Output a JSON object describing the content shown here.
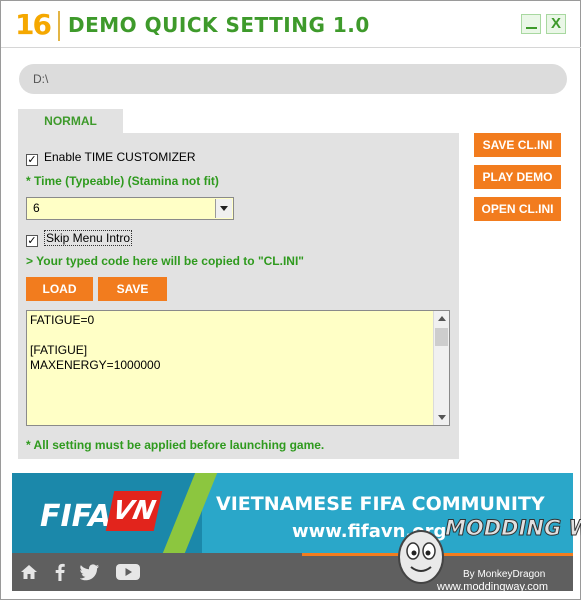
{
  "window": {
    "logo": "16",
    "title": "DEMO QUICK SETTING 1.0",
    "minimize_icon": "minimize-icon",
    "close_label": "X"
  },
  "path": {
    "value": "D:\\"
  },
  "tabs": [
    {
      "label": "NORMAL",
      "active": true
    }
  ],
  "settings": {
    "time_customizer": {
      "label": "Enable TIME CUSTOMIZER",
      "checked": true
    },
    "time_hint": "* Time (Typeable) (Stamina not fit)",
    "time_value": "6",
    "skip_intro": {
      "label": "Skip Menu Intro",
      "checked": true
    },
    "copy_hint": "> Your typed code here will be copied to \"CL.INI\"",
    "load_label": "LOAD",
    "save_label": "SAVE",
    "code_lines": [
      "FATIGUE=0",
      "",
      "[FATIGUE]",
      "MAXENERGY=1000000"
    ],
    "note": "* All setting must be applied before launching game."
  },
  "side_buttons": {
    "save_cl": "SAVE CL.INI",
    "play_demo": "PLAY DEMO",
    "open_cl": "OPEN CL.INI"
  },
  "banner": {
    "brand": "FIFA",
    "brand_badge": "VN",
    "title": "VIETNAMESE FIFA COMMUNITY",
    "url": "www.fifavn.org"
  },
  "watermark": {
    "logo_text": "MODDING WAY",
    "credit": "By MonkeyDragon",
    "url": "www.moddingway.com"
  },
  "footer": {
    "icons": [
      "home-icon",
      "facebook-icon",
      "twitter-icon",
      "youtube-icon"
    ]
  },
  "colors": {
    "accent_green": "#3e9a2b",
    "accent_orange": "#f27c1e",
    "logo_yellow": "#f5a800",
    "input_yellow": "#ffffc6",
    "panel_gray": "#e2e2e2"
  }
}
